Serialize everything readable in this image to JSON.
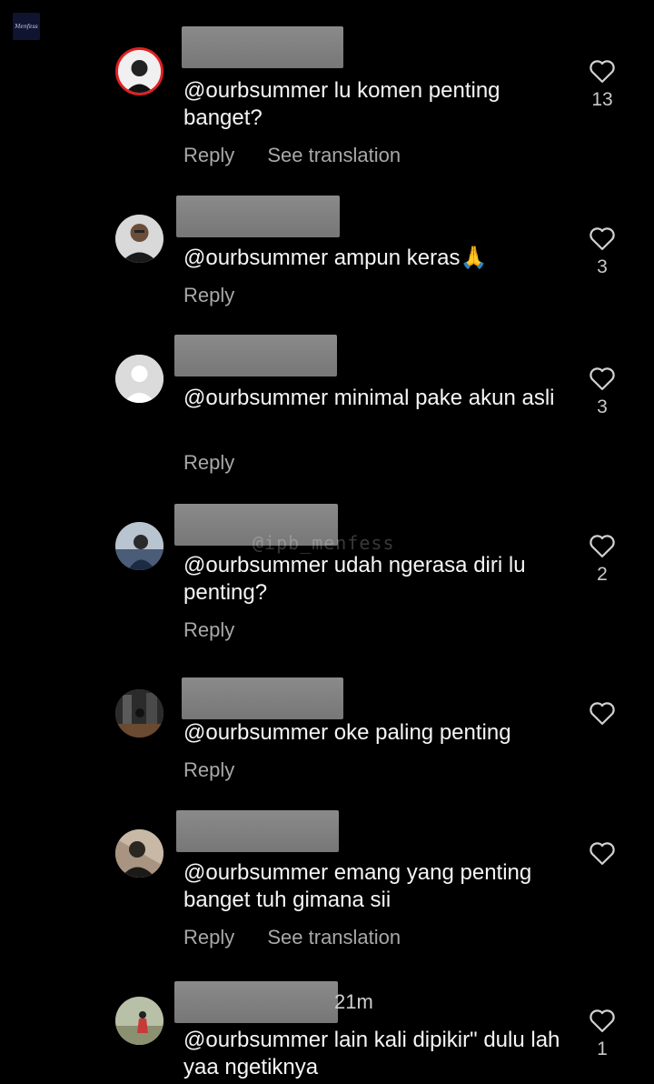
{
  "corner_logo": {
    "text": "Menfess"
  },
  "watermark": "@ipb_menfess",
  "comments": [
    {
      "text": "@ourbsummer lu komen penting banget?",
      "actions": [
        "Reply",
        "See translation"
      ],
      "likes": "13"
    },
    {
      "text": "@ourbsummer ampun keras🙏",
      "actions": [
        "Reply"
      ],
      "likes": "3"
    },
    {
      "text": "@ourbsummer minimal pake akun asli",
      "actions": [
        "Reply"
      ],
      "likes": "3"
    },
    {
      "text": "@ourbsummer udah ngerasa diri lu penting?",
      "actions": [
        "Reply"
      ],
      "likes": "2"
    },
    {
      "text": "@ourbsummer oke paling penting",
      "actions": [
        "Reply"
      ],
      "likes": ""
    },
    {
      "text": "@ourbsummer emang yang penting banget tuh gimana sii",
      "actions": [
        "Reply",
        "See translation"
      ],
      "likes": ""
    },
    {
      "time_suffix": "21m",
      "text": "@ourbsummer lain kali dipikir\" dulu lah yaa ngetiknya",
      "actions": [],
      "likes": "1"
    }
  ],
  "colors": {
    "background": "#000000",
    "text": "#f5f5f5",
    "muted": "#a8a8a8",
    "redacted": "#808080"
  }
}
